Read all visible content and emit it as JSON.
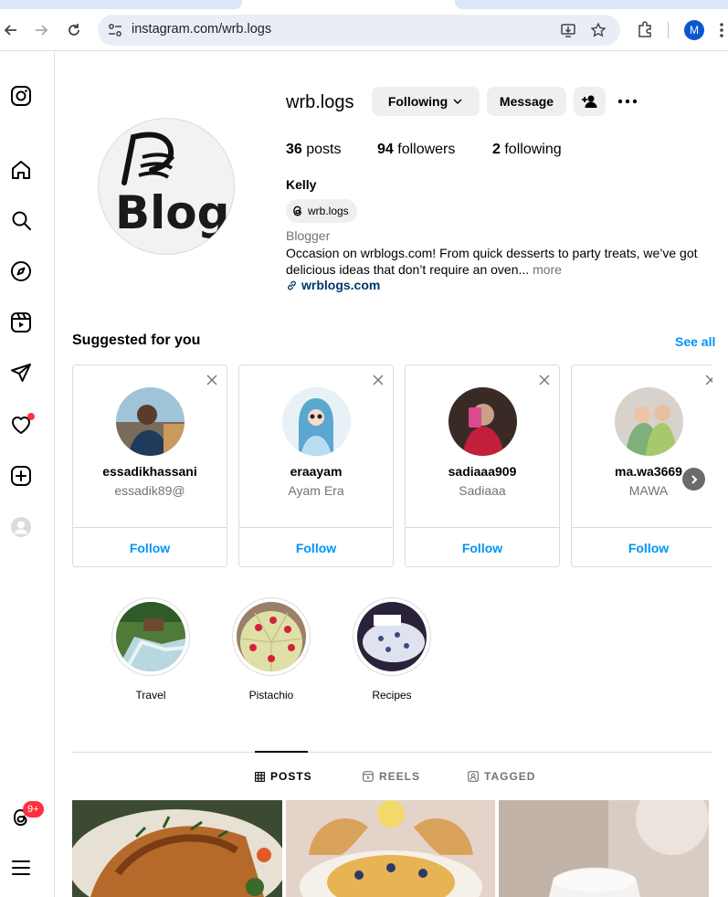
{
  "browser": {
    "url": "instagram.com/wrb.logs",
    "profile_initial": "M"
  },
  "sidebar": {
    "notification_count": "9+"
  },
  "profile": {
    "username": "wrb.logs",
    "following_button": "Following",
    "message_button": "Message",
    "posts_count": "36",
    "posts_label": "posts",
    "followers_count": "94",
    "followers_label": "followers",
    "following_count": "2",
    "following_label": "following",
    "full_name": "Kelly",
    "threads_handle": "wrb.logs",
    "category": "Blogger",
    "bio": "Occasion on wrblogs.com! From quick desserts to party treats, we’ve got delicious ideas that don’t require an oven...",
    "bio_more": "more",
    "website": "wrblogs.com",
    "logo_text": "Blog"
  },
  "suggestions": {
    "title": "Suggested for you",
    "see_all": "See all",
    "follow_label": "Follow",
    "items": [
      {
        "username": "essadikhassani",
        "subtitle": "essadik89@"
      },
      {
        "username": "eraayam",
        "subtitle": "Ayam Era"
      },
      {
        "username": "sadiaaa909",
        "subtitle": "Sadiaaa"
      },
      {
        "username": "ma.wa3669",
        "subtitle": "MAWA"
      }
    ]
  },
  "highlights": [
    {
      "label": "Travel"
    },
    {
      "label": "Pistachio"
    },
    {
      "label": "Recipes"
    }
  ],
  "tabs": {
    "posts": "POSTS",
    "reels": "REELS",
    "tagged": "TAGGED"
  },
  "colors": {
    "accent_blue": "#0095f6",
    "link_blue": "#00376b",
    "notification_red": "#ff3040"
  }
}
